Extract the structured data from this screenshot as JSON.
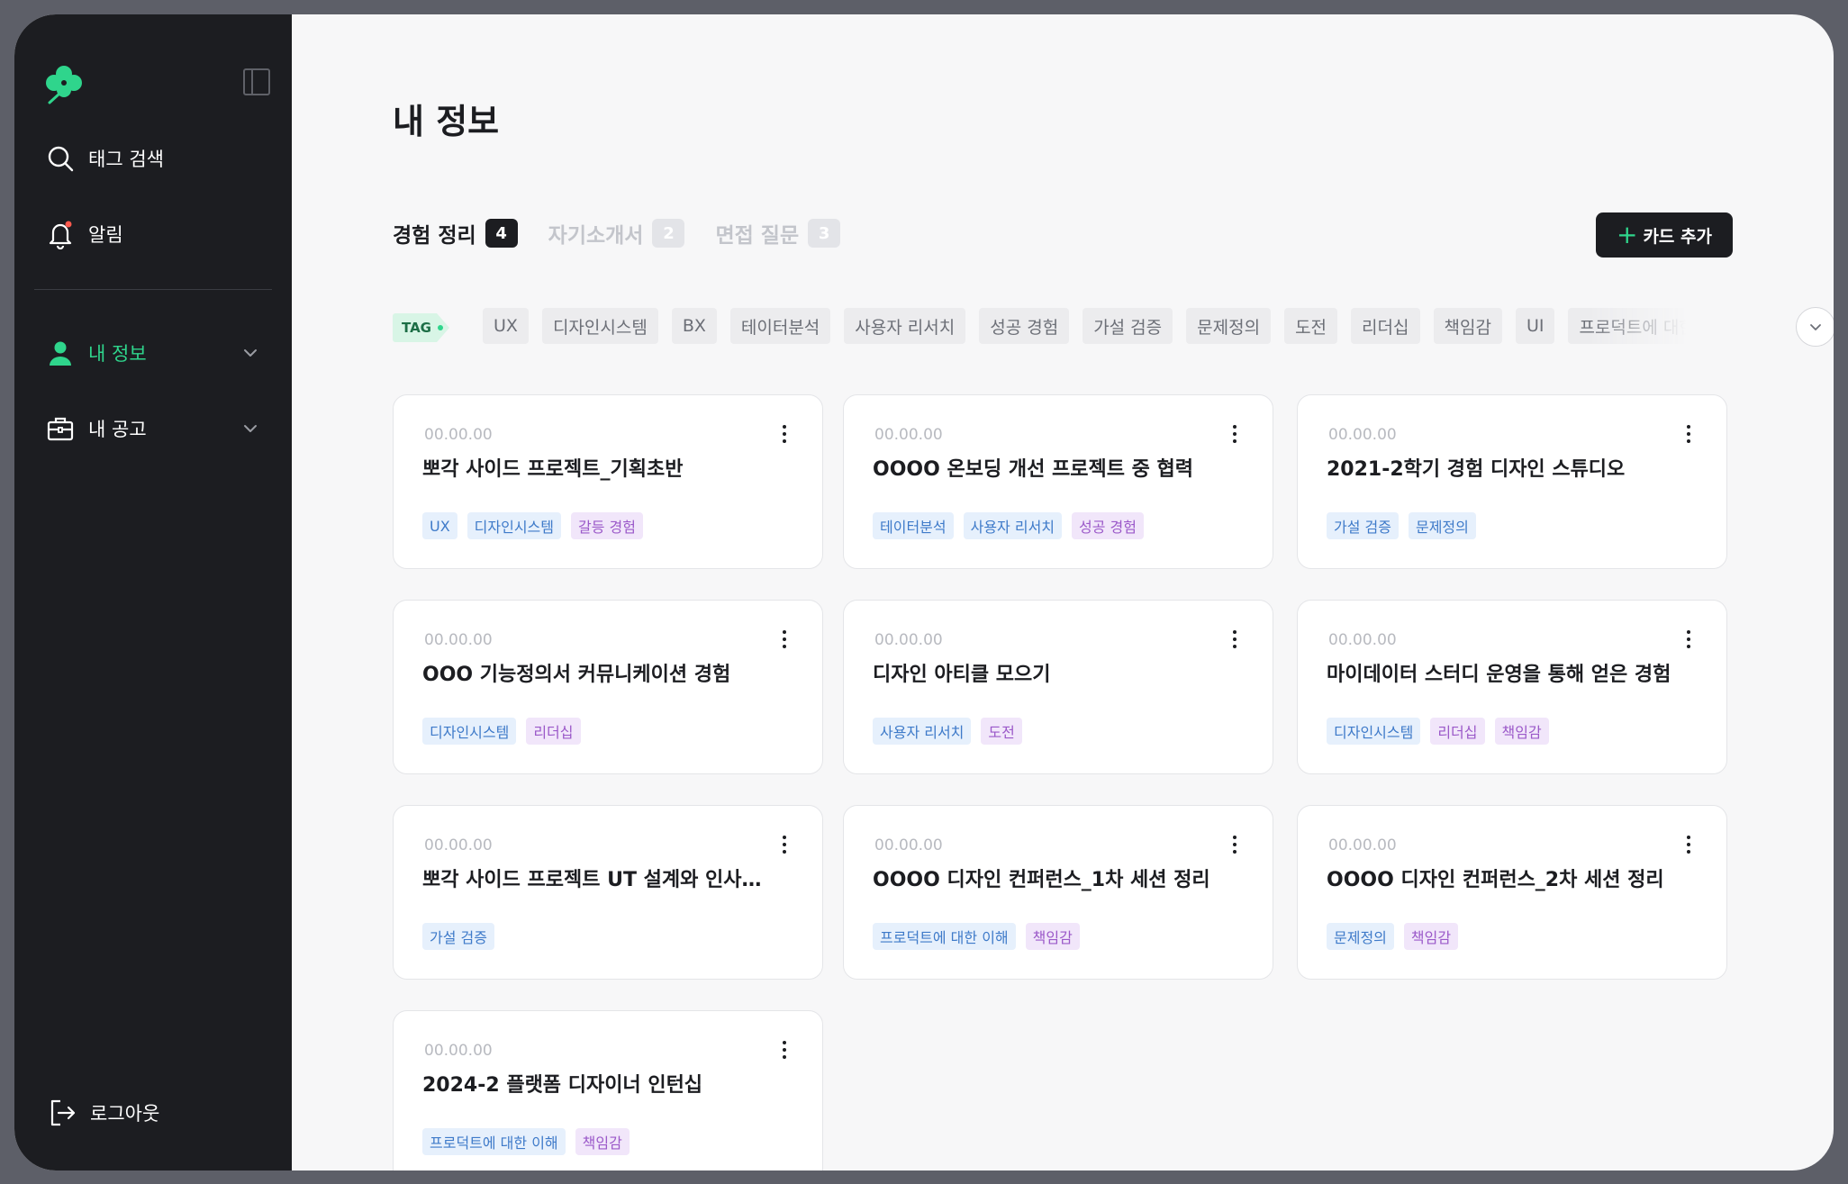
{
  "sidebar": {
    "nav": [
      {
        "label": "태그 검색",
        "icon": "search-icon"
      },
      {
        "label": "알림",
        "icon": "bell-icon"
      },
      {
        "label": "내 정보",
        "icon": "user-icon",
        "active": true
      },
      {
        "label": "내 공고",
        "icon": "briefcase-icon"
      }
    ],
    "logout": "로그아웃"
  },
  "main": {
    "title": "내 정보",
    "tabs": [
      {
        "label": "경험 정리",
        "count": "4"
      },
      {
        "label": "자기소개서",
        "count": "2"
      },
      {
        "label": "면접 질문",
        "count": "3"
      }
    ],
    "add_button": "카드 추가",
    "tag_label": "TAG",
    "filter_tags": [
      "UX",
      "디자인시스템",
      "BX",
      "테이터분석",
      "사용자 리서치",
      "성공 경험",
      "가설 검증",
      "문제정의",
      "도전",
      "리더십",
      "책임감",
      "UI",
      "프로덕트에 대한 이해"
    ],
    "cards": [
      {
        "date": "00.00.00",
        "title": "뽀각 사이드 프로젝트_기획초반",
        "tags": [
          {
            "t": "UX",
            "c": "blue"
          },
          {
            "t": "디자인시스템",
            "c": "blue"
          },
          {
            "t": "갈등 경험",
            "c": "purple"
          }
        ]
      },
      {
        "date": "00.00.00",
        "title": "OOOO 온보딩 개선 프로젝트 중 협력",
        "tags": [
          {
            "t": "테이터분석",
            "c": "blue"
          },
          {
            "t": "사용자 리서치",
            "c": "blue"
          },
          {
            "t": "성공 경험",
            "c": "purple"
          }
        ]
      },
      {
        "date": "00.00.00",
        "title": "2021-2학기 경험 디자인 스튜디오",
        "tags": [
          {
            "t": "가설 검증",
            "c": "blue"
          },
          {
            "t": "문제정의",
            "c": "blue"
          }
        ]
      },
      {
        "date": "00.00.00",
        "title": "OOO 기능정의서 커뮤니케이션 경험",
        "tags": [
          {
            "t": "디자인시스템",
            "c": "blue"
          },
          {
            "t": "리더십",
            "c": "purple"
          }
        ]
      },
      {
        "date": "00.00.00",
        "title": "디자인 아티클 모으기",
        "tags": [
          {
            "t": "사용자 리서치",
            "c": "blue"
          },
          {
            "t": "도전",
            "c": "purple"
          }
        ]
      },
      {
        "date": "00.00.00",
        "title": "마이데이터 스터디 운영을 통해 얻은 경험",
        "tags": [
          {
            "t": "디자인시스템",
            "c": "blue"
          },
          {
            "t": "리더십",
            "c": "purple"
          },
          {
            "t": "책임감",
            "c": "purple"
          }
        ]
      },
      {
        "date": "00.00.00",
        "title": "뽀각 사이드 프로젝트 UT 설계와 인사이트 도출",
        "tags": [
          {
            "t": "가설 검증",
            "c": "blue"
          }
        ]
      },
      {
        "date": "00.00.00",
        "title": "OOOO 디자인 컨퍼런스_1차 세션 정리",
        "tags": [
          {
            "t": "프로덕트에 대한 이해",
            "c": "blue"
          },
          {
            "t": "책임감",
            "c": "purple"
          }
        ]
      },
      {
        "date": "00.00.00",
        "title": "OOOO 디자인 컨퍼런스_2차 세션 정리",
        "tags": [
          {
            "t": "문제정의",
            "c": "blue"
          },
          {
            "t": "책임감",
            "c": "purple"
          }
        ]
      },
      {
        "date": "00.00.00",
        "title": "2024-2 플랫폼 디자이너 인턴십",
        "tags": [
          {
            "t": "프로덕트에 대한 이해",
            "c": "blue"
          },
          {
            "t": "책임감",
            "c": "purple"
          }
        ]
      }
    ]
  },
  "colors": {
    "accent": "#2fd58c",
    "sidebar_bg": "#1c1d21",
    "page_bg": "#f7f7f8"
  }
}
